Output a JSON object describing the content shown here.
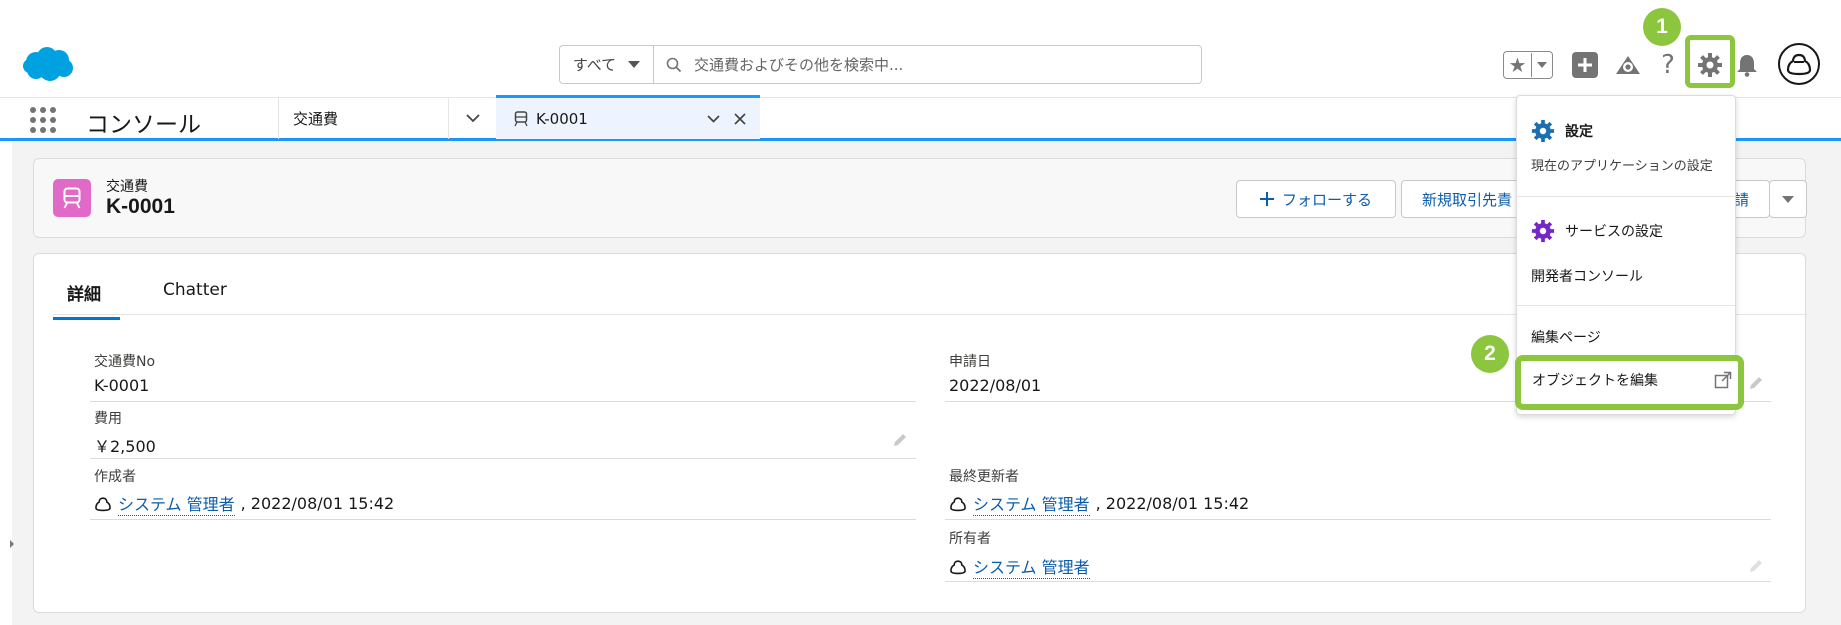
{
  "header": {
    "search_scope": "すべて",
    "search_placeholder": "交通費およびその他を検索中..."
  },
  "nav": {
    "app_name": "コンソール",
    "nav_item": "交通費",
    "active_tab": "K-0001"
  },
  "record": {
    "type": "交通費",
    "name": "K-0001",
    "buttons": {
      "follow": "フォローする",
      "new_partner": "新規取引先責",
      "apply": "請"
    }
  },
  "tabs": {
    "details": "詳細",
    "chatter": "Chatter"
  },
  "fields": {
    "no_label": "交通費No",
    "no_value": "K-0001",
    "date_label": "申請日",
    "date_value": "2022/08/01",
    "cost_label": "費用",
    "cost_value": "￥2,500",
    "created_label": "作成者",
    "created_user": "システム 管理者",
    "created_time": ", 2022/08/01 15:42",
    "modified_label": "最終更新者",
    "modified_user": "システム 管理者",
    "modified_time": ", 2022/08/01 15:42",
    "owner_label": "所有者",
    "owner_user": "システム 管理者"
  },
  "setup_menu": {
    "setup": "設定",
    "setup_sub": "現在のアプリケーションの設定",
    "service_setup": "サービスの設定",
    "dev_console": "開発者コンソール",
    "edit_page": "編集ページ",
    "edit_object": "オブジェクトを編集"
  },
  "annotations": {
    "step1": "1",
    "step2": "2"
  },
  "colors": {
    "brand": "#00a1e0",
    "accent": "#1b96ff",
    "highlight": "#8cc63f",
    "record_icon": "#e169c8"
  }
}
